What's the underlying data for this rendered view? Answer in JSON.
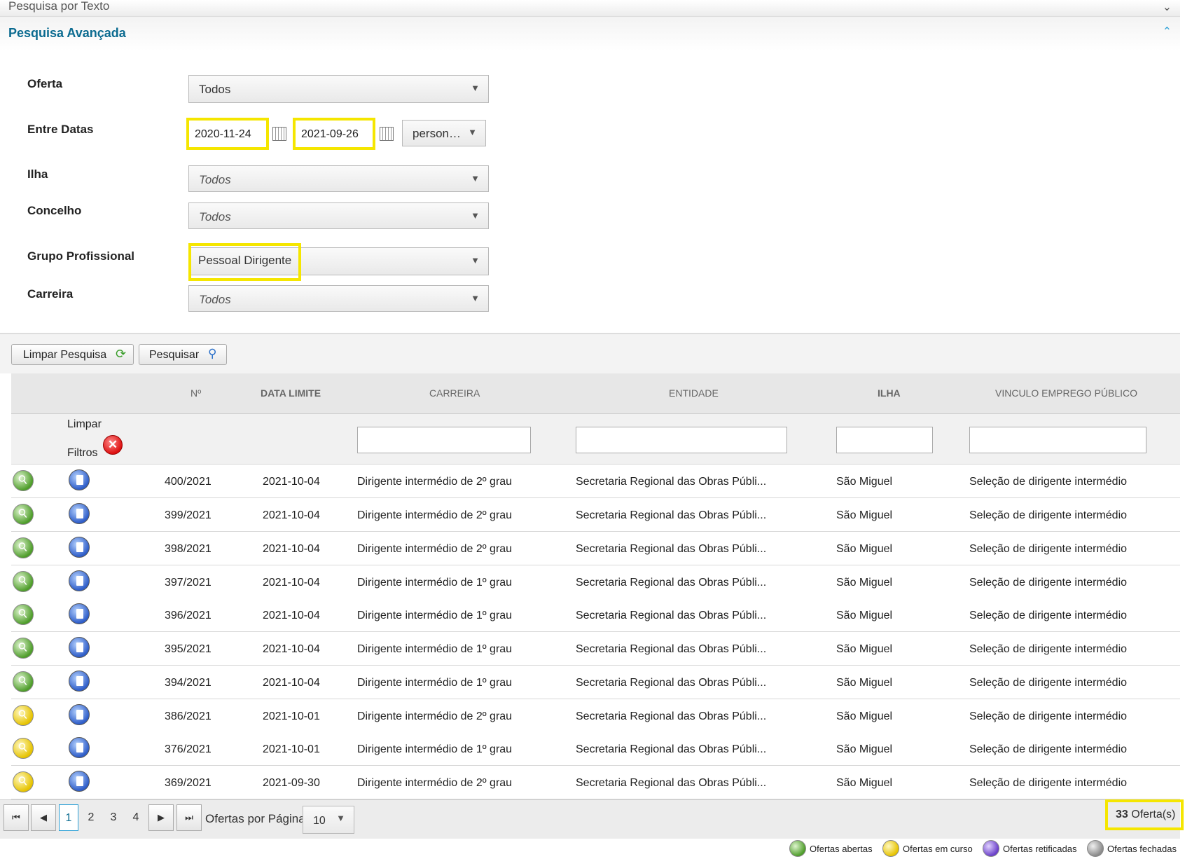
{
  "accordion": {
    "text_search_title": "Pesquisa por Texto",
    "advanced_search_title": "Pesquisa Avançada"
  },
  "filters": {
    "oferta": {
      "label": "Oferta",
      "value": "Todos"
    },
    "entre_datas": {
      "label": "Entre Datas",
      "start": "2020-11-24",
      "end": "2021-09-26",
      "mode": "person…"
    },
    "ilha": {
      "label": "Ilha",
      "value": "Todos"
    },
    "concelho": {
      "label": "Concelho",
      "value": "Todos"
    },
    "grupo_profissional": {
      "label": "Grupo Profissional",
      "value": "Pessoal Dirigente"
    },
    "carreira": {
      "label": "Carreira",
      "value": "Todos"
    }
  },
  "toolbar": {
    "clear_label": "Limpar Pesquisa",
    "search_label": "Pesquisar"
  },
  "table": {
    "headers": {
      "numero": "Nº",
      "data_limite": "DATA LIMITE",
      "carreira": "CARREIRA",
      "entidade": "ENTIDADE",
      "ilha": "ILHA",
      "vinculo": "VINCULO EMPREGO PÚBLICO"
    },
    "clear_filters_line1": "Limpar",
    "clear_filters_line2": "Filtros",
    "rows": [
      {
        "status": "open",
        "numero": "400/2021",
        "data": "2021-10-04",
        "carreira": "Dirigente intermédio de 2º grau",
        "entidade": "Secretaria Regional das Obras Públi...",
        "ilha": "São Miguel",
        "vinculo": "Seleção de dirigente intermédio"
      },
      {
        "status": "open",
        "numero": "399/2021",
        "data": "2021-10-04",
        "carreira": "Dirigente intermédio de 2º grau",
        "entidade": "Secretaria Regional das Obras Públi...",
        "ilha": "São Miguel",
        "vinculo": "Seleção de dirigente intermédio"
      },
      {
        "status": "open",
        "numero": "398/2021",
        "data": "2021-10-04",
        "carreira": "Dirigente intermédio de 2º grau",
        "entidade": "Secretaria Regional das Obras Públi...",
        "ilha": "São Miguel",
        "vinculo": "Seleção de dirigente intermédio"
      },
      {
        "status": "open",
        "numero": "397/2021",
        "data": "2021-10-04",
        "carreira": "Dirigente intermédio de 1º grau",
        "entidade": "Secretaria Regional das Obras Públi...",
        "ilha": "São Miguel",
        "vinculo": "Seleção de dirigente intermédio"
      },
      {
        "status": "open",
        "numero": "396/2021",
        "data": "2021-10-04",
        "carreira": "Dirigente intermédio de 1º grau",
        "entidade": "Secretaria Regional das Obras Públi...",
        "ilha": "São Miguel",
        "vinculo": "Seleção de dirigente intermédio"
      },
      {
        "status": "open",
        "numero": "395/2021",
        "data": "2021-10-04",
        "carreira": "Dirigente intermédio de 1º grau",
        "entidade": "Secretaria Regional das Obras Públi...",
        "ilha": "São Miguel",
        "vinculo": "Seleção de dirigente intermédio"
      },
      {
        "status": "open",
        "numero": "394/2021",
        "data": "2021-10-04",
        "carreira": "Dirigente intermédio de 1º grau",
        "entidade": "Secretaria Regional das Obras Públi...",
        "ilha": "São Miguel",
        "vinculo": "Seleção de dirigente intermédio"
      },
      {
        "status": "curso",
        "numero": "386/2021",
        "data": "2021-10-01",
        "carreira": "Dirigente intermédio de 2º grau",
        "entidade": "Secretaria Regional das Obras Públi...",
        "ilha": "São Miguel",
        "vinculo": "Seleção de dirigente intermédio"
      },
      {
        "status": "curso",
        "numero": "376/2021",
        "data": "2021-10-01",
        "carreira": "Dirigente intermédio de 1º grau",
        "entidade": "Secretaria Regional das Obras Públi...",
        "ilha": "São Miguel",
        "vinculo": "Seleção de dirigente intermédio"
      },
      {
        "status": "curso",
        "numero": "369/2021",
        "data": "2021-09-30",
        "carreira": "Dirigente intermédio de 2º grau",
        "entidade": "Secretaria Regional das Obras Públi...",
        "ilha": "São Miguel",
        "vinculo": "Seleção de dirigente intermédio"
      }
    ]
  },
  "pagination": {
    "pages": [
      "1",
      "2",
      "3",
      "4"
    ],
    "current": "1",
    "per_page_label": "Ofertas por Página",
    "per_page_value": "10",
    "total_count": "33",
    "total_suffix": "Oferta(s)"
  },
  "legend": {
    "open": "Ofertas abertas",
    "curso": "Ofertas em curso",
    "retificadas": "Ofertas retificadas",
    "fechadas": "Ofertas fechadas"
  },
  "colors": {
    "accent": "#0b6b90",
    "highlight": "#f5e600",
    "open": "#4e9d2a",
    "curso": "#e6c300",
    "retificadas": "#6a3fc9",
    "fechadas": "#8a8a8a"
  }
}
